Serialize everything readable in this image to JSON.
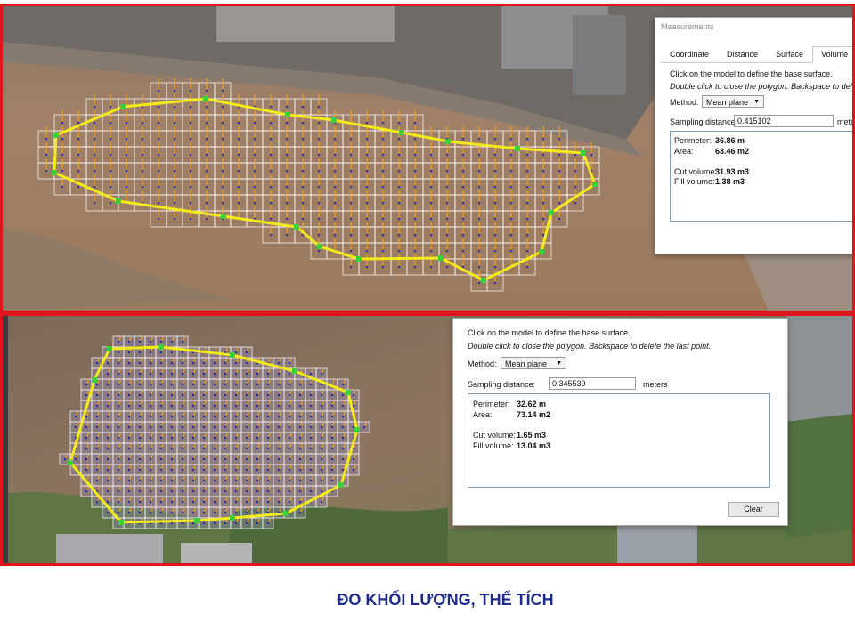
{
  "top": {
    "dialog_title": "Measurements",
    "tabs": [
      {
        "label": "Coordinate"
      },
      {
        "label": "Distance"
      },
      {
        "label": "Surface"
      },
      {
        "label": "Volume"
      }
    ],
    "instruction1": "Click on the model to define the base surface.",
    "instruction2": "Double click to close the polygon. Backspace to delete the l",
    "method_label": "Method:",
    "method_value": "Mean plane",
    "sampling_label": "Sampling distance:",
    "sampling_value": "0.415102",
    "sampling_unit": "meters",
    "results": {
      "perimeter_label": "Perimeter:",
      "perimeter_value": "36.86 m",
      "area_label": "Area:",
      "area_value": "63.46 m2",
      "cut_label": "Cut volume:",
      "cut_value": "31.93 m3",
      "fill_label": "Fill volume:",
      "fill_value": "1.38 m3"
    }
  },
  "bottom": {
    "instruction1": "Click on the model to define the base surface.",
    "instruction2": "Double click to close the polygon. Backspace to delete the last point.",
    "method_label": "Method:",
    "method_value": "Mean plane",
    "sampling_label": "Sampling distance:",
    "sampling_value": "0.345539",
    "sampling_unit": "meters",
    "results": {
      "perimeter_label": "Perimeter:",
      "perimeter_value": "32.62 m",
      "area_label": "Area:",
      "area_value": "73.14 m2",
      "cut_label": "Cut volume:",
      "cut_value": "1.65 m3",
      "fill_label": "Fill volume:",
      "fill_value": "13.04 m3"
    },
    "clear_label": "Clear"
  },
  "caption": "ĐO KHỐI LƯỢNG, THỂ TÍCH",
  "colors": {
    "frame": "#e0141c",
    "caption": "#1f2a8a",
    "polygon_edge": "#f2ea1a",
    "vertex": "#3bd13b",
    "grid": "#ffffff",
    "vector": "#f0a020",
    "sample_point": "#2a2aa0"
  }
}
